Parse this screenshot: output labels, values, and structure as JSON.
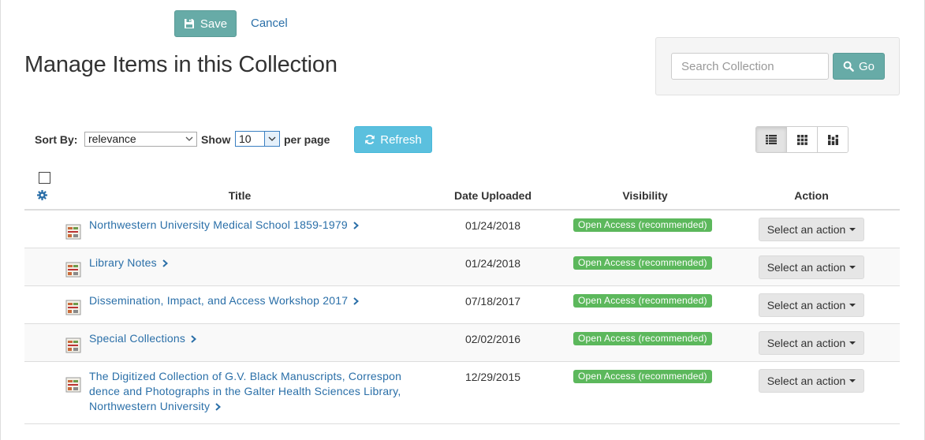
{
  "toolbar": {
    "save_label": "Save",
    "cancel_label": "Cancel"
  },
  "page_title": "Manage Items in this Collection",
  "search": {
    "placeholder": "Search Collection",
    "value": "",
    "go_label": "Go"
  },
  "controls": {
    "sort_label": "Sort By:",
    "sort_value": "relevance",
    "show_label": "Show",
    "per_page_value": "10",
    "per_page_suffix": "per page",
    "refresh_label": "Refresh"
  },
  "view_modes": [
    "list-view-icon",
    "gallery-view-icon",
    "masonry-view-icon"
  ],
  "active_view": "list",
  "table": {
    "columns": [
      "Title",
      "Date Uploaded",
      "Visibility",
      "Action"
    ],
    "rows": [
      {
        "title": "Northwestern University Medical School 1859-1979",
        "date": "01/24/2018",
        "visibility": "Open Access (recommended)",
        "action": "Select an action"
      },
      {
        "title": "Library Notes",
        "date": "01/24/2018",
        "visibility": "Open Access (recommended)",
        "action": "Select an action"
      },
      {
        "title": "Dissemination, Impact, and Access Workshop 2017",
        "date": "07/18/2017",
        "visibility": "Open Access (recommended)",
        "action": "Select an action"
      },
      {
        "title": "Special Collections",
        "date": "02/02/2016",
        "visibility": "Open Access (recommended)",
        "action": "Select an action"
      },
      {
        "title_lines": [
          "The Digitized Collection of G.V. Black Manuscripts, Correspon",
          "dence and Photographs in the Galter Health Sciences Library,",
          "Northwestern University"
        ],
        "date": "12/29/2015",
        "visibility": "Open Access (recommended)",
        "action": "Select an action"
      }
    ]
  },
  "colors": {
    "primary_teal": "#67aba7",
    "info_blue": "#5bc0de",
    "success_green": "#5cb85c",
    "link_blue": "#2a6fa8"
  }
}
